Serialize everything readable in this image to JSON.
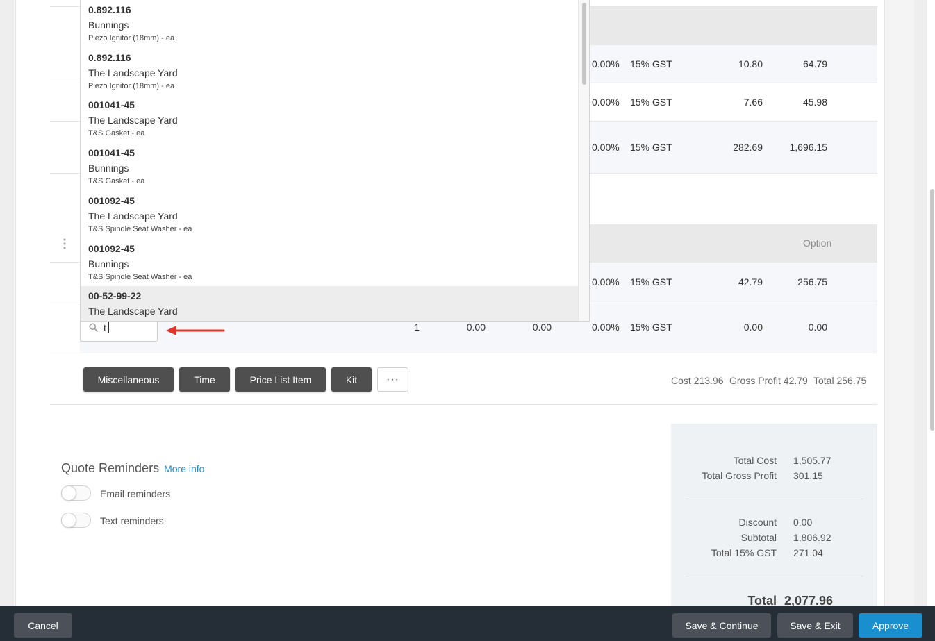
{
  "dropdown": {
    "items": [
      {
        "code": "0.892.116",
        "supplier": "Bunnings",
        "desc": "Piezo Ignitor (18mm) - ea"
      },
      {
        "code": "0.892.116",
        "supplier": "The Landscape Yard",
        "desc": "Piezo Ignitor (18mm) - ea"
      },
      {
        "code": "001041-45",
        "supplier": "The Landscape Yard",
        "desc": "T&S Gasket - ea"
      },
      {
        "code": "001041-45",
        "supplier": "Bunnings",
        "desc": "T&S Gasket - ea"
      },
      {
        "code": "001092-45",
        "supplier": "The Landscape Yard",
        "desc": "T&S Spindle Seat Washer - ea"
      },
      {
        "code": "001092-45",
        "supplier": "Bunnings",
        "desc": "T&S Spindle Seat Washer - ea"
      },
      {
        "code": "00-52-99-22",
        "supplier": "The Landscape Yard",
        "desc": ""
      }
    ]
  },
  "rows": [
    {
      "disc": "0.00%",
      "tax": "15% GST",
      "amount1": "10.80",
      "amount2": "64.79"
    },
    {
      "disc": "0.00%",
      "tax": "15% GST",
      "amount1": "7.66",
      "amount2": "45.98"
    },
    {
      "disc": "0.00%",
      "tax": "15% GST",
      "amount1": "282.69",
      "amount2": "1,696.15"
    }
  ],
  "section2": {
    "header_option": "Option",
    "row": {
      "disc": "0.00%",
      "tax": "15% GST",
      "amount1": "42.79",
      "amount2": "256.75"
    },
    "new_row": {
      "qty": "1",
      "price": "0.00",
      "cost": "0.00",
      "disc": "0.00%",
      "tax": "15% GST",
      "amount1": "0.00",
      "amount2": "0.00"
    }
  },
  "search": {
    "value": "t"
  },
  "add_buttons": {
    "misc": "Miscellaneous",
    "time": "Time",
    "price_list": "Price List Item",
    "kit": "Kit",
    "more": "···"
  },
  "section_totals": {
    "cost": "Cost 213.96",
    "gross_profit": "Gross Profit 42.79",
    "total": "Total 256.75"
  },
  "reminders": {
    "title": "Quote Reminders",
    "more_info": "More info",
    "email": "Email reminders",
    "text": "Text reminders"
  },
  "summary": {
    "total_cost_label": "Total Cost",
    "total_cost": "1,505.77",
    "total_gp_label": "Total Gross Profit",
    "total_gp": "301.15",
    "discount_label": "Discount",
    "discount": "0.00",
    "subtotal_label": "Subtotal",
    "subtotal": "1,806.92",
    "gst_label": "Total 15% GST",
    "gst": "271.04",
    "total_label": "Total",
    "total": "2,077.96"
  },
  "footer": {
    "cancel": "Cancel",
    "save_continue": "Save & Continue",
    "save_exit": "Save & Exit",
    "approve": "Approve"
  },
  "colors": {
    "accent": "#1a8fd0",
    "footer": "#252d36",
    "arrow": "#e0362c"
  }
}
